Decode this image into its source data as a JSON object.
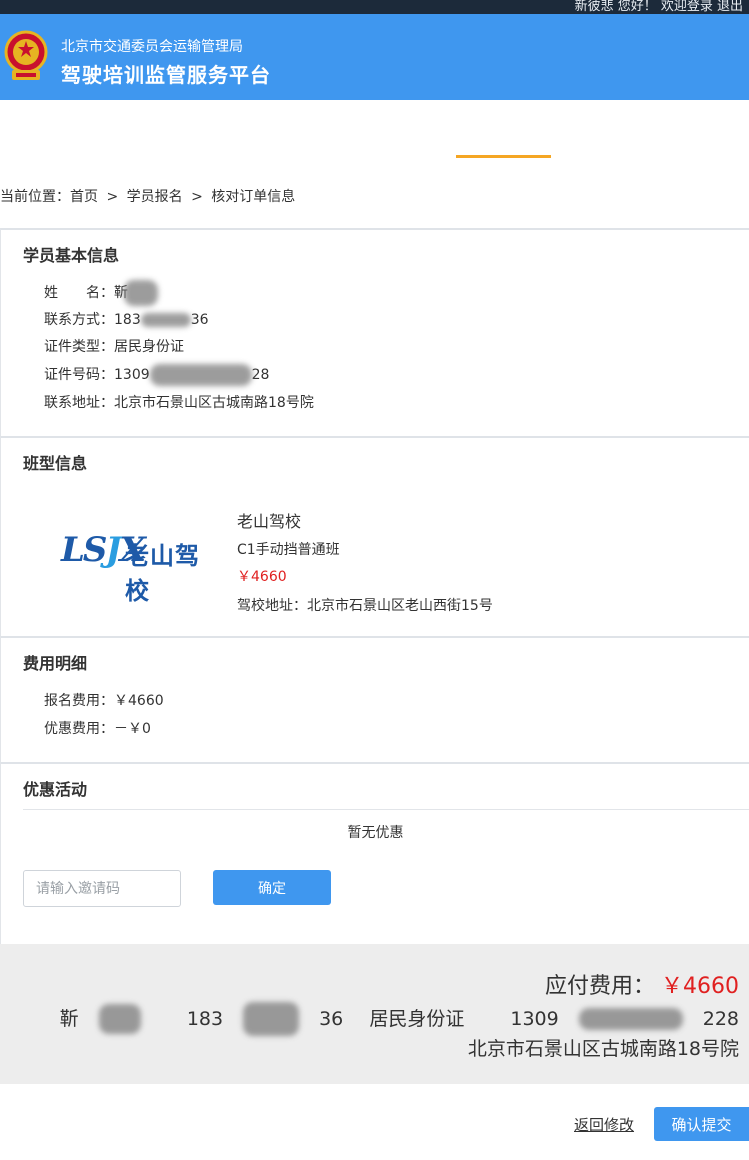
{
  "topbar": {
    "links_text": "新彼悲 您好！ 欢迎登录 退出"
  },
  "header": {
    "org": "北京市交通委员会运输管理局",
    "platform": "驾驶培训监管服务平台"
  },
  "breadcrumb": {
    "prefix": "当前位置：",
    "items": [
      "首页",
      "学员报名",
      "核对订单信息"
    ],
    "separator": ">"
  },
  "student_info": {
    "title": "学员基本信息",
    "name_label": "姓　　名：",
    "name_value": "靳",
    "phone_label": "联系方式：",
    "phone_start": "183",
    "phone_end": "36",
    "id_type_label": "证件类型：",
    "id_type_value": "居民身份证",
    "id_number_label": "证件号码：",
    "id_number_start": "1309",
    "id_number_end": "28",
    "address_label": "联系地址：",
    "address_value": "北京市石景山区古城南路18号院"
  },
  "class_info": {
    "title": "班型信息",
    "logo_text_latin": "LSJX",
    "logo_text_cn": "老山驾校",
    "school_name": "老山驾校",
    "class_name": "C1手动挡普通班",
    "price": "￥4660",
    "school_address_label": "驾校地址：",
    "school_address": "北京市石景山区老山西街15号"
  },
  "fees": {
    "title": "费用明细",
    "signup_label": "报名费用：",
    "signup_value": "￥4660",
    "discount_label": "优惠费用：",
    "discount_value": "－￥0"
  },
  "promo": {
    "title": "优惠活动",
    "empty_text": "暂无优惠",
    "invite_placeholder": "请输入邀请码",
    "confirm_label": "确定"
  },
  "summary": {
    "payable_label": "应付费用：",
    "payable_value": "￥4660",
    "name_start": "靳",
    "phone_start": "183",
    "phone_end": "36",
    "id_type": "居民身份证",
    "id_start": "1309",
    "id_end": "228",
    "address": "北京市石景山区古城南路18号院"
  },
  "actions": {
    "back_label": "返回修改",
    "submit_label": "确认提交"
  },
  "colors": {
    "header_bg": "#3f97ef",
    "accent_orange": "#f5a623",
    "price_red": "#e02020",
    "summary_bg": "#ededed"
  }
}
